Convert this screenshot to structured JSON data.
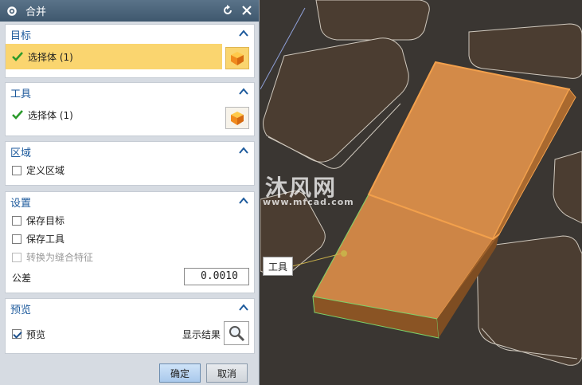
{
  "dialog": {
    "title": "合并",
    "target": {
      "header": "目标",
      "select_label": "选择体 (1)"
    },
    "tool": {
      "header": "工具",
      "select_label": "选择体 (1)"
    },
    "region": {
      "header": "区域",
      "define_region": "定义区域"
    },
    "settings": {
      "header": "设置",
      "keep_target": "保存目标",
      "keep_tool": "保存工具",
      "convert_to_seam": "转换为缝合特征",
      "tolerance_label": "公差",
      "tolerance_value": "0.0010"
    },
    "preview": {
      "header": "预览",
      "preview_label": "预览",
      "show_result": "显示结果",
      "preview_checked": true
    },
    "buttons": {
      "ok": "确定",
      "cancel": "取消"
    }
  },
  "viewport": {
    "tool_tag": "工具",
    "watermark_text": "沐风网",
    "watermark_url": "www.mfcad.com"
  },
  "colors": {
    "accent": "#1d5a9c",
    "highlight": "#fad56f",
    "model_orange": "#d98c45",
    "background": "#3a3632"
  }
}
